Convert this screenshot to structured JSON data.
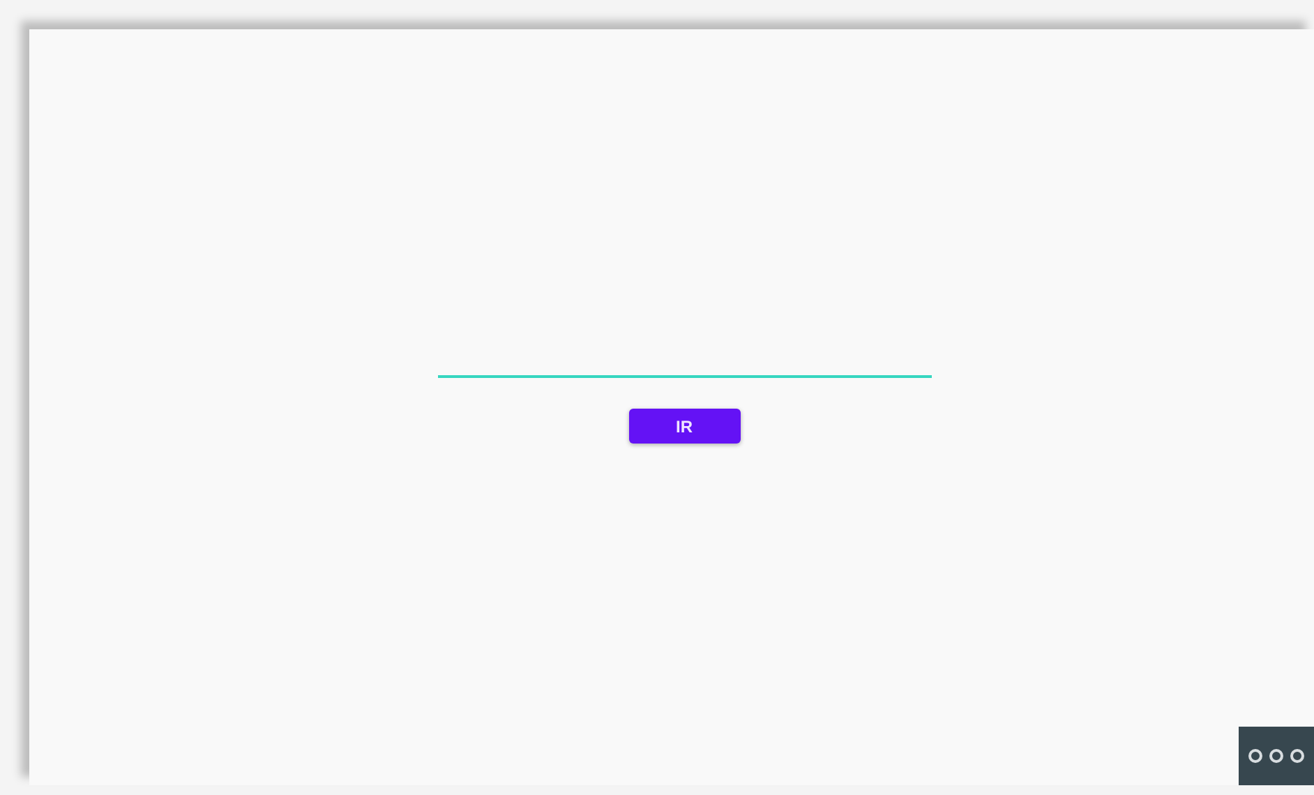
{
  "form": {
    "submit_button": {
      "label": "IR"
    }
  }
}
